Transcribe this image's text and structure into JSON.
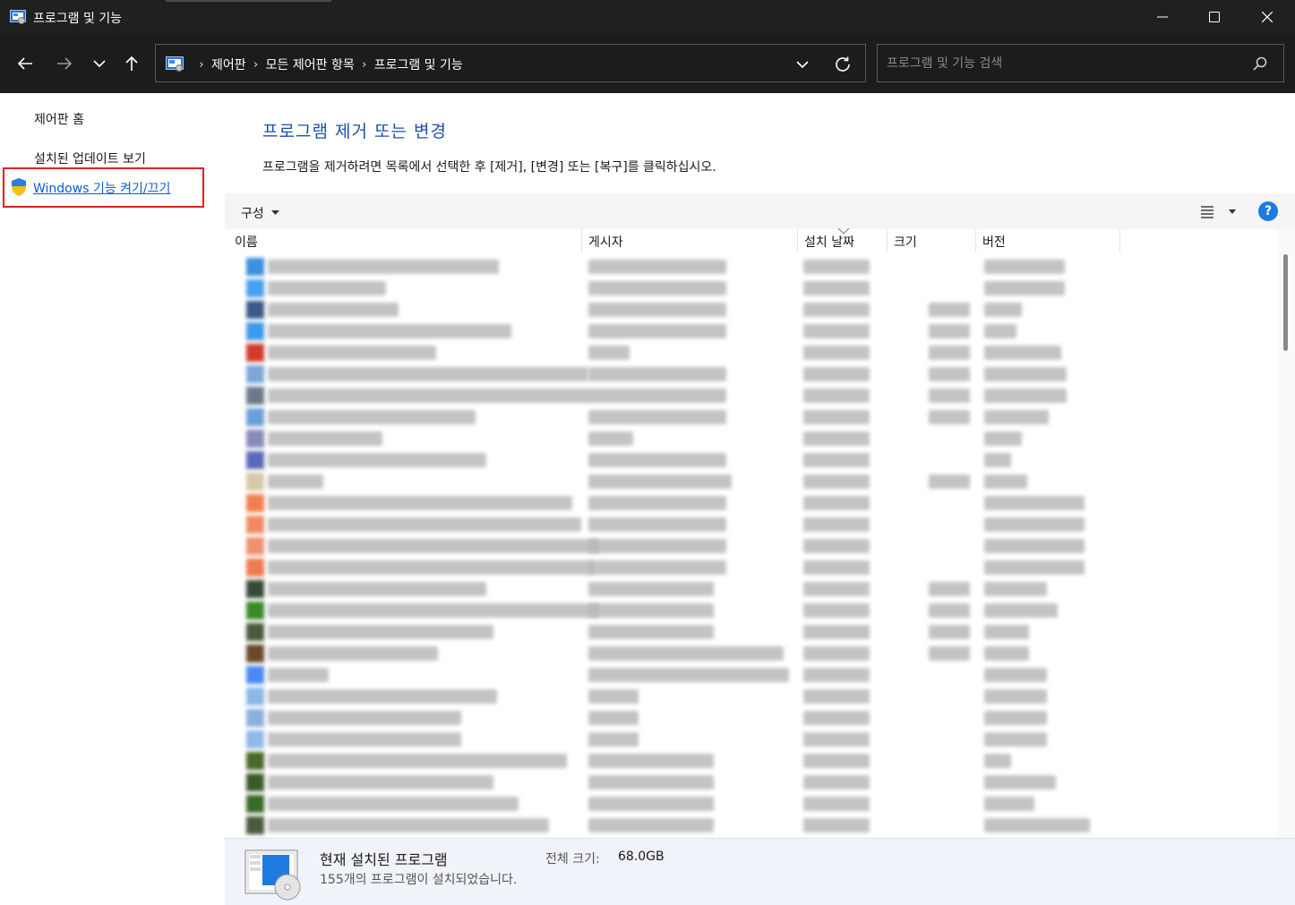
{
  "window": {
    "title": "프로그램 및 기능"
  },
  "address": {
    "crumbs": [
      "제어판",
      "모든 제어판 항목",
      "프로그램 및 기능"
    ]
  },
  "search": {
    "placeholder": "프로그램 및 기능 검색"
  },
  "sidebar": {
    "home": "제어판 홈",
    "updates": "설치된 업데이트 보기",
    "features": "Windows 기능 켜기/끄기"
  },
  "main": {
    "title": "프로그램 제거 또는 변경",
    "description": "프로그램을 제거하려면 목록에서 선택한 후 [제거], [변경] 또는 [복구]를 클릭하십시오.",
    "organize_label": "구성",
    "help_label": "?"
  },
  "columns": {
    "name": "이름",
    "publisher": "게시자",
    "install_date": "설치 날짜",
    "size": "크기",
    "version": "버전"
  },
  "details": {
    "title": "현재 설치된 프로그램",
    "count_text": "155개의 프로그램이 설치되었습니다.",
    "size_label": "전체 크기:",
    "size_value": "68.0GB"
  },
  "colors": {
    "titlebar": "#202020",
    "link": "#0b5cd6",
    "heading": "#1e4fa8",
    "highlight_border": "#e02020"
  }
}
